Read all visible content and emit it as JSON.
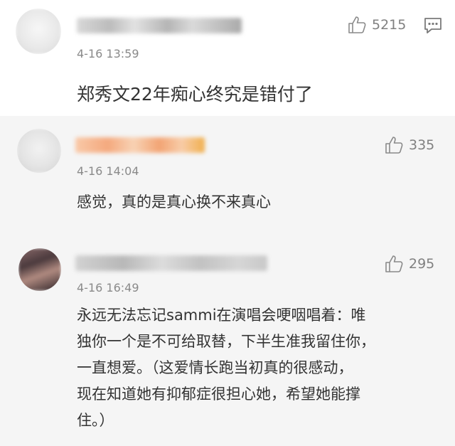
{
  "comments": [
    {
      "likes": "5215",
      "time": "4-16 13:59",
      "text": "郑秀文22年痴心终究是错付了"
    },
    {
      "likes": "335",
      "time": "4-16 14:04",
      "text": "感觉，真的是真心换不来真心"
    },
    {
      "likes": "295",
      "time": "4-16 16:49",
      "text_lines": [
        "永远无法忘记sammi在演唱会哽咽唱着：唯",
        "独你一个是不可给取替，下半生准我留住你，",
        "一直想爱。（这爱情长跑当初真的很感动，",
        "现在知道她有抑郁症很担心她，希望她能撑",
        "住。）"
      ]
    }
  ],
  "icons": {
    "like": "thumbs-up-icon",
    "reply": "comment-icon"
  },
  "colors": {
    "text": "#333333",
    "meta": "#8a8a8a",
    "count": "#808080",
    "alt_background": "#f5f5f5"
  }
}
